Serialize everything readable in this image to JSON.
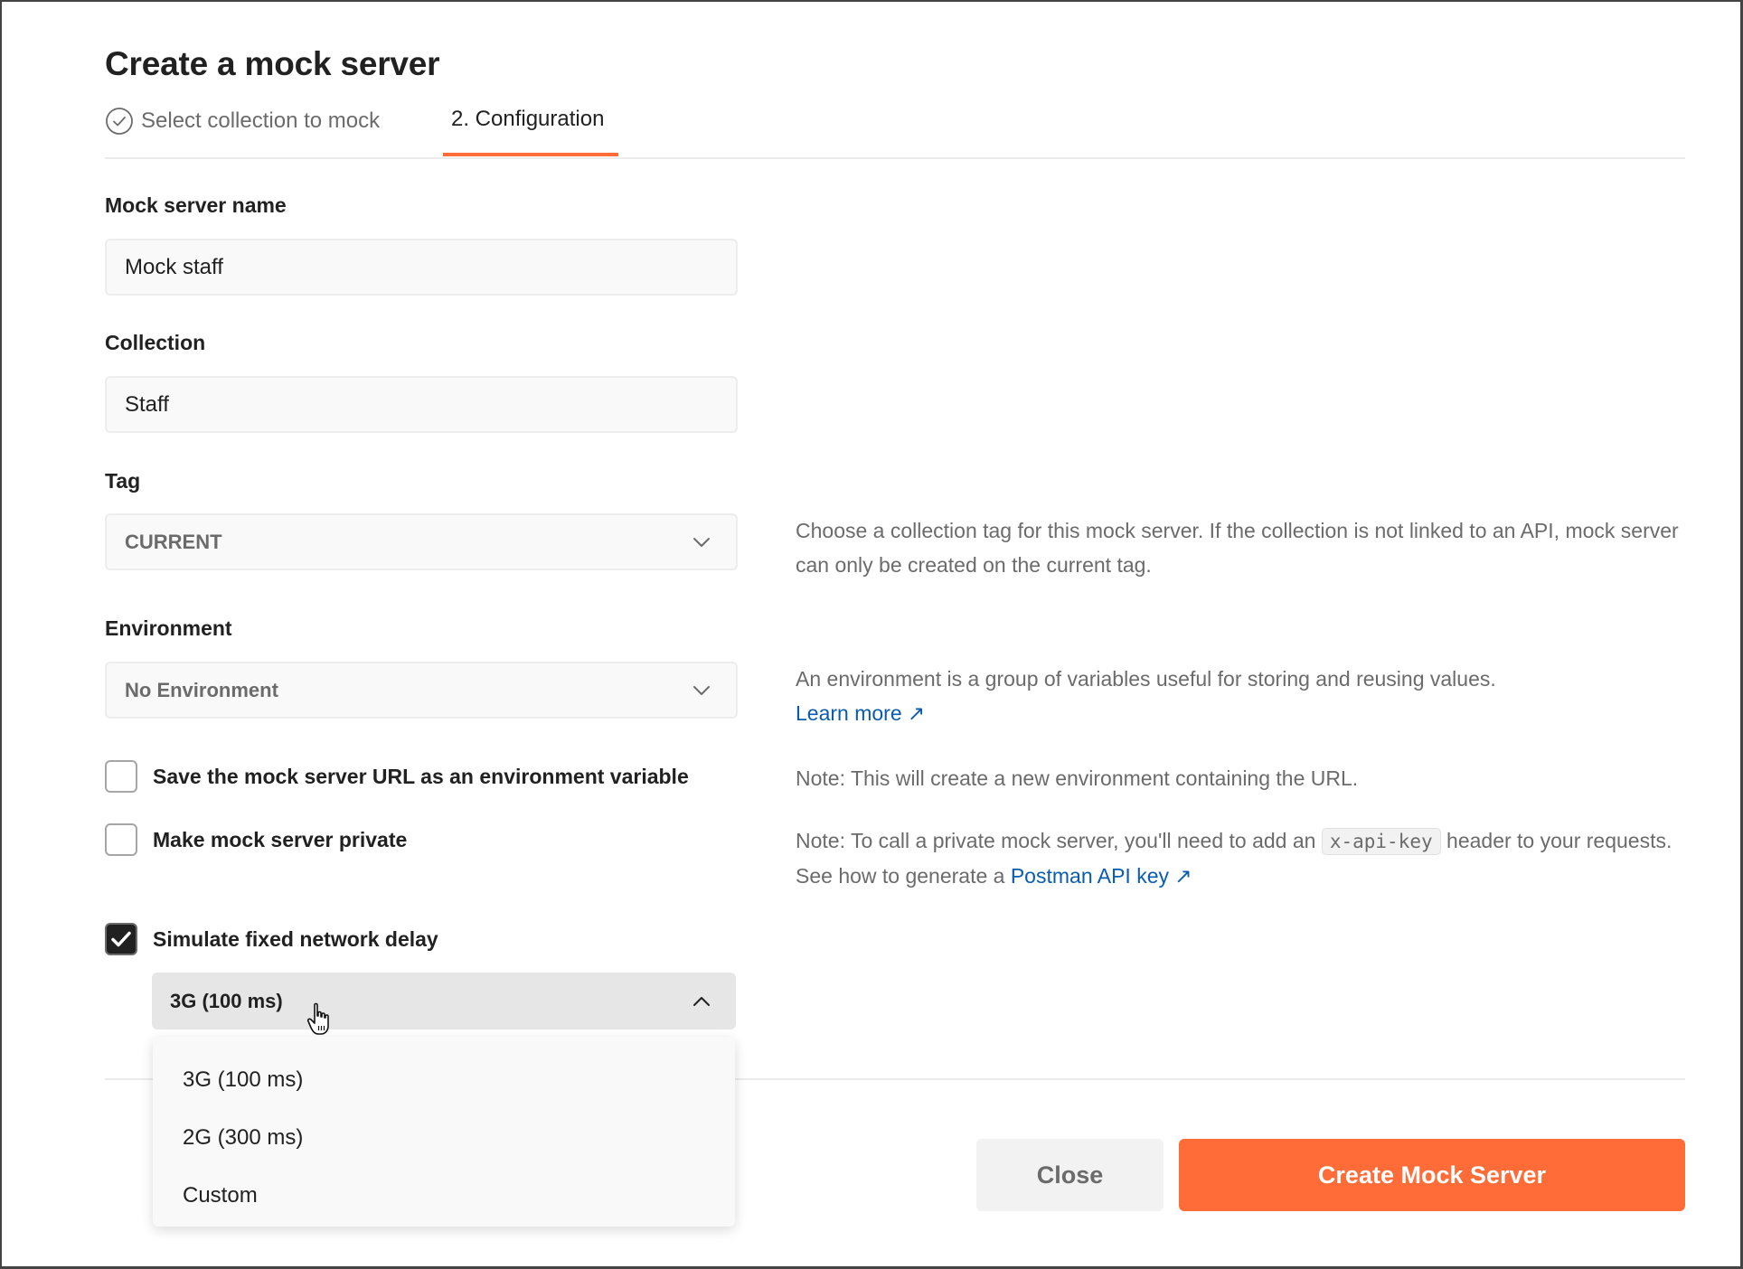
{
  "dialog": {
    "title": "Create a mock server"
  },
  "steps": [
    {
      "label": "Select collection to mock",
      "state": "completed",
      "icon": "check-circle-icon"
    },
    {
      "label": "2. Configuration",
      "state": "active"
    }
  ],
  "form": {
    "mock_server_name": {
      "label": "Mock server name",
      "value": "Mock staff"
    },
    "collection": {
      "label": "Collection",
      "value": "Staff"
    },
    "tag": {
      "label": "Tag",
      "selected": "CURRENT",
      "help": "Choose a collection tag for this mock server. If the collection is not linked to an API, mock server can only be created on the current tag."
    },
    "environment": {
      "label": "Environment",
      "selected": "No Environment",
      "help": "An environment is a group of variables useful for storing and reusing values.",
      "learn_more": "Learn more"
    },
    "save_url_env": {
      "label": "Save the mock server URL as an environment variable",
      "checked": false,
      "note": "Note: This will create a new environment containing the URL."
    },
    "private": {
      "label": "Make mock server private",
      "checked": false,
      "note_prefix": "Note: To call a private mock server, you'll need to add an",
      "note_code": "x-api-key",
      "note_mid": "header to your requests. See how to generate a",
      "note_link": "Postman API key"
    },
    "network_delay": {
      "label": "Simulate fixed network delay",
      "checked": true,
      "selected": "3G (100 ms)",
      "dropdown_open": true,
      "options": [
        "3G (100 ms)",
        "2G (300 ms)",
        "Custom"
      ]
    }
  },
  "footer": {
    "close_label": "Close",
    "create_label": "Create Mock Server"
  },
  "colors": {
    "accent": "#ff6c37",
    "link": "#0b5cad",
    "text": "#212121",
    "muted": "#6b6b6b"
  }
}
